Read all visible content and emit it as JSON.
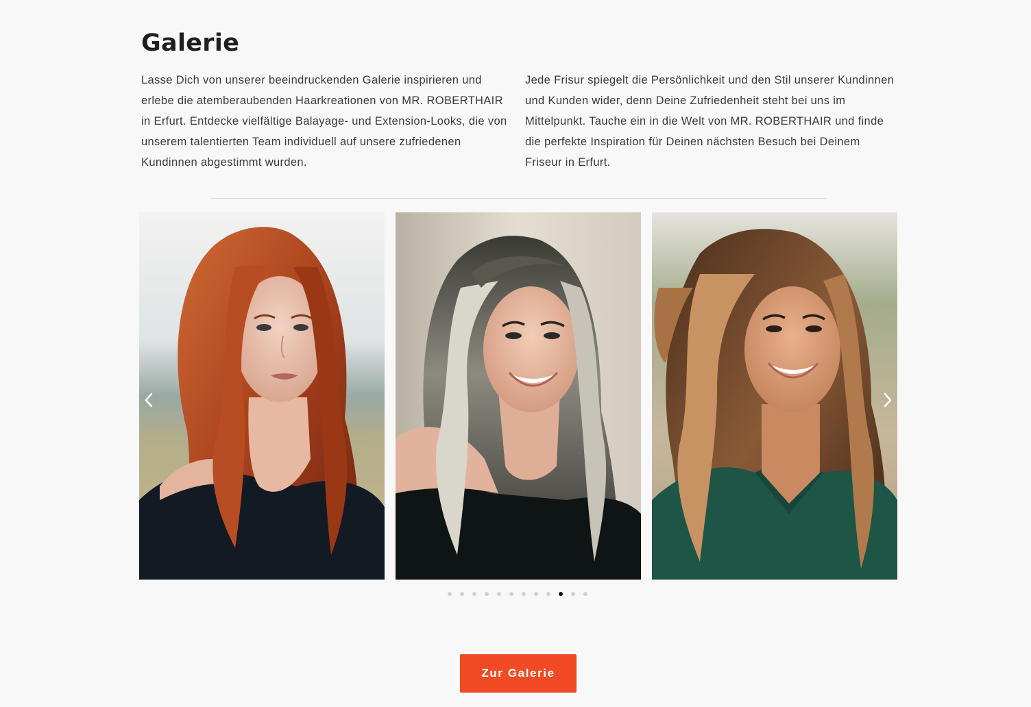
{
  "gallery": {
    "title": "Galerie",
    "intro_left": "Lasse Dich von unserer beeindruckenden Galerie inspirieren und erlebe die atemberaubenden Haarkreationen von MR. ROBERTHAIR in Erfurt. Entdecke vielfältige Balayage- und Extension-Looks, die von unserem talentierten Team individuell auf unsere zufriedenen Kundinnen abgestimmt wurden.",
    "intro_right": "Jede Frisur spiegelt die Persönlichkeit und den Stil unserer Kundinnen und Kunden wider, denn Deine Zufriedenheit steht bei uns im Mittelpunkt. Tauche ein in die Welt von MR. ROBERTHAIR und finde die perfekte Inspiration für Deinen nächsten Besuch bei Deinem Friseur in Erfurt."
  },
  "carousel": {
    "slides": [
      {
        "subject": "woman with long wavy copper-red hair, dark off-shoulder top",
        "hair": "#a8401c",
        "hair_light": "#d06a35",
        "top": "#121a24",
        "bg": "#c9c5b0"
      },
      {
        "subject": "smiling woman with dark hair and silver-grey balayage waves, black top",
        "hair": "#3a3a34",
        "hair_light": "#d9d6cc",
        "top": "#0f1414",
        "bg": "#d8d0c4"
      },
      {
        "subject": "smiling woman with brown hair and caramel balayage, green top",
        "hair": "#4a2e1e",
        "hair_light": "#c89362",
        "top": "#1e5546",
        "bg": "#b5b49a"
      }
    ],
    "prev_icon": "chevron-left-icon",
    "next_icon": "chevron-right-icon",
    "dot_count": 12,
    "active_dot_index": 9
  },
  "cta": {
    "label": "Zur Galerie",
    "color": "#f24a24"
  }
}
